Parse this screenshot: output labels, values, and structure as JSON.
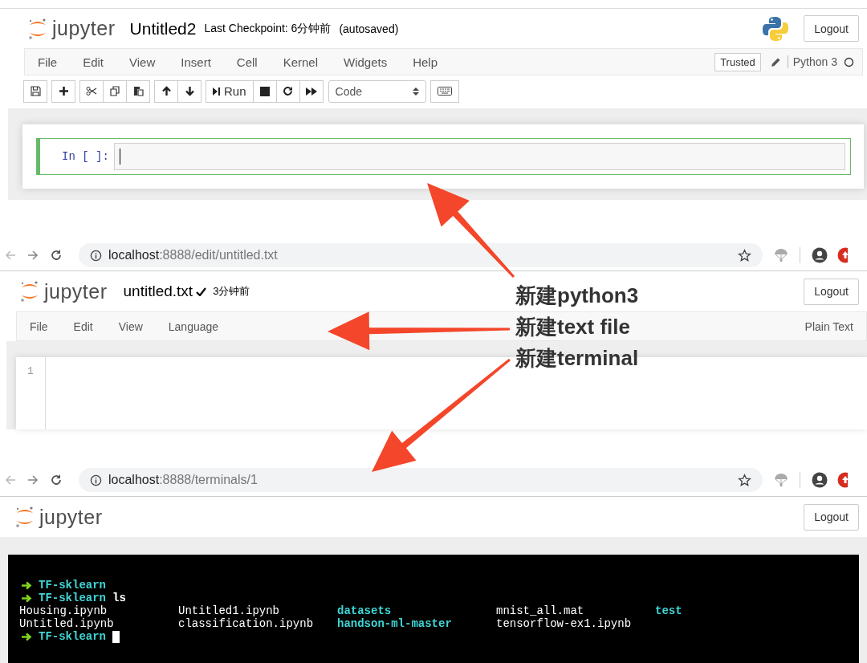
{
  "notebook": {
    "logo": "jupyter",
    "title": "Untitled2",
    "checkpoint": "Last Checkpoint: 6分钟前",
    "autosave": "(autosaved)",
    "logout": "Logout",
    "menu": [
      "File",
      "Edit",
      "View",
      "Insert",
      "Cell",
      "Kernel",
      "Widgets",
      "Help"
    ],
    "trusted": "Trusted",
    "kernel": "Python 3",
    "run_label": "Run",
    "cell_type": "Code",
    "prompt": "In [ ]:"
  },
  "editor": {
    "browser": {
      "host": "localhost",
      "path": ":8888/edit/untitled.txt"
    },
    "logo": "jupyter",
    "title": "untitled.txt",
    "saved_time": "3分钟前",
    "logout": "Logout",
    "menu": [
      "File",
      "Edit",
      "View",
      "Language"
    ],
    "mode": "Plain Text",
    "line_numbers": [
      "1"
    ]
  },
  "terminal_page": {
    "browser": {
      "host": "localhost",
      "path": ":8888/terminals/1"
    },
    "logo": "jupyter",
    "logout": "Logout",
    "lines": [
      {
        "kind": "prompt",
        "dir": "TF-sklearn",
        "cursor": false
      },
      {
        "kind": "prompt",
        "dir": "TF-sklearn",
        "command": "ls",
        "cursor": false
      },
      {
        "kind": "listing",
        "entries": [
          {
            "name": "Housing.ipynb",
            "kind": "file"
          },
          {
            "name": "Untitled1.ipynb",
            "kind": "file"
          },
          {
            "name": "datasets",
            "kind": "dir"
          },
          {
            "name": "mnist_all.mat",
            "kind": "file"
          },
          {
            "name": "test",
            "kind": "dir"
          }
        ]
      },
      {
        "kind": "listing",
        "entries": [
          {
            "name": "Untitled.ipynb",
            "kind": "file"
          },
          {
            "name": "classification.ipynb",
            "kind": "file"
          },
          {
            "name": "handson-ml-master",
            "kind": "dir"
          },
          {
            "name": "tensorflow-ex1.ipynb",
            "kind": "file"
          }
        ]
      },
      {
        "kind": "prompt",
        "dir": "TF-sklearn",
        "cursor": true
      }
    ]
  },
  "annotations": [
    {
      "text": "新建python3"
    },
    {
      "text": "新建text file"
    },
    {
      "text": "新建terminal"
    }
  ]
}
